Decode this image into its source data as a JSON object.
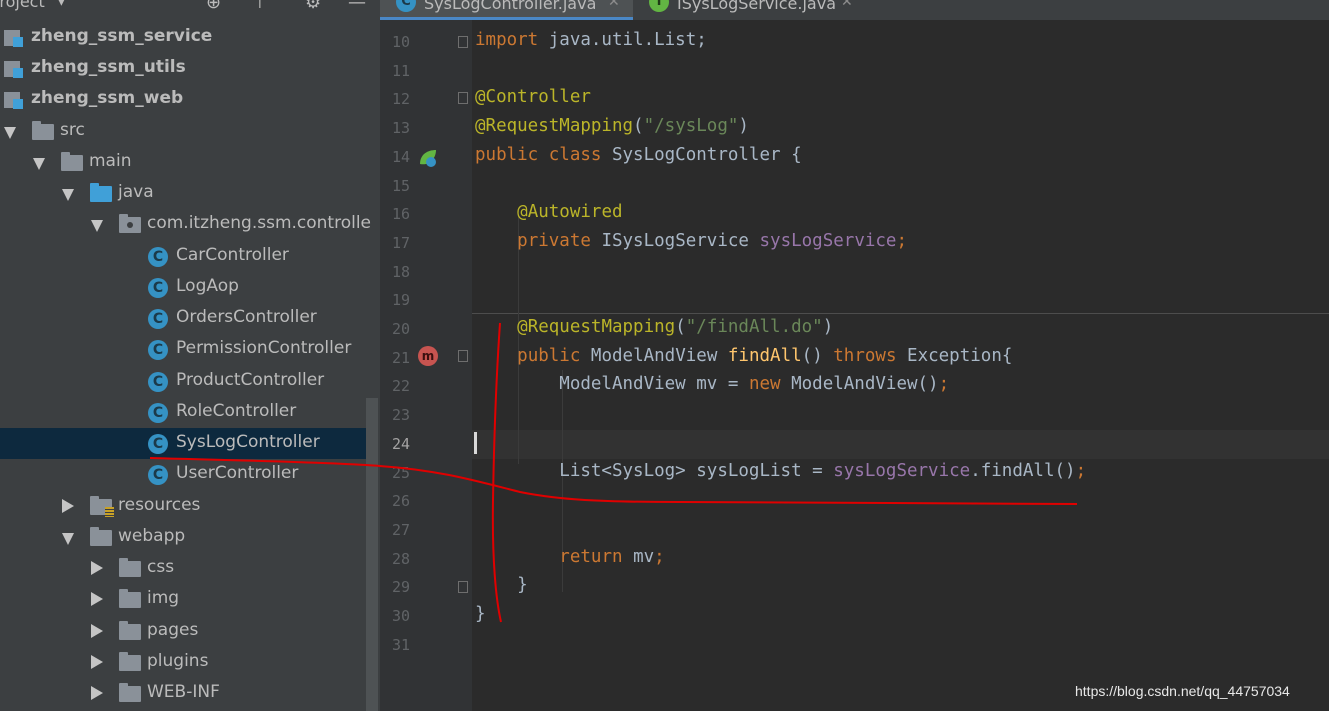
{
  "project_panel": {
    "title": "Project",
    "items": [
      {
        "label": "zheng_ssm_service",
        "icon": "module-icon",
        "expand": "none",
        "bold": true
      },
      {
        "label": "zheng_ssm_utils",
        "icon": "module-icon",
        "expand": "none",
        "bold": true
      },
      {
        "label": "zheng_ssm_web",
        "icon": "module-icon",
        "expand": "none",
        "bold": true
      },
      {
        "label": "src",
        "icon": "folder-icon",
        "expand": "down"
      },
      {
        "label": "main",
        "icon": "folder-icon",
        "expand": "down"
      },
      {
        "label": "java",
        "icon": "source-folder-icon",
        "expand": "down"
      },
      {
        "label": "com.itzheng.ssm.controlle",
        "icon": "package-icon",
        "expand": "down"
      },
      {
        "label": "CarController",
        "icon": "class-icon"
      },
      {
        "label": "LogAop",
        "icon": "class-icon"
      },
      {
        "label": "OrdersController",
        "icon": "class-icon"
      },
      {
        "label": "PermissionController",
        "icon": "class-icon"
      },
      {
        "label": "ProductController",
        "icon": "class-icon"
      },
      {
        "label": "RoleController",
        "icon": "class-icon"
      },
      {
        "label": "SysLogController",
        "icon": "class-icon",
        "selected": true
      },
      {
        "label": "UserController",
        "icon": "class-icon"
      },
      {
        "label": "resources",
        "icon": "resources-folder-icon",
        "expand": "right"
      },
      {
        "label": "webapp",
        "icon": "folder-icon",
        "expand": "down"
      },
      {
        "label": "css",
        "icon": "folder-icon",
        "expand": "right"
      },
      {
        "label": "img",
        "icon": "folder-icon",
        "expand": "right"
      },
      {
        "label": "pages",
        "icon": "folder-icon",
        "expand": "right"
      },
      {
        "label": "plugins",
        "icon": "folder-icon",
        "expand": "right"
      },
      {
        "label": "WEB-INF",
        "icon": "folder-icon",
        "expand": "right"
      }
    ]
  },
  "tabs": [
    {
      "label": "SysLogController.java",
      "icon": "class-icon",
      "active": true
    },
    {
      "label": "ISysLogService.java",
      "icon": "interface-icon",
      "active": false
    }
  ],
  "editor": {
    "current_line": 24,
    "lines": [
      {
        "num": "10",
        "tokens": [
          {
            "t": "import",
            "c": "kw"
          },
          {
            "t": " java.util.List;",
            "c": ""
          }
        ]
      },
      {
        "num": "11",
        "tokens": []
      },
      {
        "num": "12",
        "tokens": [
          {
            "t": "@Controller",
            "c": "an"
          }
        ]
      },
      {
        "num": "13",
        "tokens": [
          {
            "t": "@RequestMapping",
            "c": "an"
          },
          {
            "t": "(",
            "c": ""
          },
          {
            "t": "\"/sysLog\"",
            "c": "str"
          },
          {
            "t": ")",
            "c": ""
          }
        ]
      },
      {
        "num": "14",
        "tokens": [
          {
            "t": "public class ",
            "c": "kw"
          },
          {
            "t": "SysLogController {",
            "c": ""
          }
        ]
      },
      {
        "num": "15",
        "tokens": []
      },
      {
        "num": "16",
        "tokens": [
          {
            "t": "    ",
            "c": ""
          },
          {
            "t": "@Autowired",
            "c": "an"
          }
        ]
      },
      {
        "num": "17",
        "tokens": [
          {
            "t": "    ",
            "c": ""
          },
          {
            "t": "private ",
            "c": "kw"
          },
          {
            "t": "ISysLogService ",
            "c": ""
          },
          {
            "t": "sysLogService",
            "c": "fld"
          },
          {
            "t": ";",
            "c": "kw"
          }
        ]
      },
      {
        "num": "18",
        "tokens": []
      },
      {
        "num": "19",
        "tokens": []
      },
      {
        "num": "20",
        "tokens": [
          {
            "t": "    ",
            "c": ""
          },
          {
            "t": "@RequestMapping",
            "c": "an"
          },
          {
            "t": "(",
            "c": ""
          },
          {
            "t": "\"/findAll.do\"",
            "c": "str"
          },
          {
            "t": ")",
            "c": ""
          }
        ]
      },
      {
        "num": "21",
        "tokens": [
          {
            "t": "    ",
            "c": ""
          },
          {
            "t": "public ",
            "c": "kw"
          },
          {
            "t": "ModelAndView ",
            "c": ""
          },
          {
            "t": "findAll",
            "c": "mth"
          },
          {
            "t": "() ",
            "c": ""
          },
          {
            "t": "throws ",
            "c": "kw"
          },
          {
            "t": "Exception{",
            "c": ""
          }
        ]
      },
      {
        "num": "22",
        "tokens": [
          {
            "t": "        ModelAndView mv = ",
            "c": ""
          },
          {
            "t": "new ",
            "c": "kw"
          },
          {
            "t": "ModelAndView()",
            "c": ""
          },
          {
            "t": ";",
            "c": "kw"
          }
        ]
      },
      {
        "num": "23",
        "tokens": []
      },
      {
        "num": "24",
        "tokens": []
      },
      {
        "num": "25",
        "tokens": [
          {
            "t": "        List<SysLog> sysLogList = ",
            "c": ""
          },
          {
            "t": "sysLogService",
            "c": "fld"
          },
          {
            "t": ".findAll()",
            "c": ""
          },
          {
            "t": ";",
            "c": "kw"
          }
        ]
      },
      {
        "num": "26",
        "tokens": []
      },
      {
        "num": "27",
        "tokens": []
      },
      {
        "num": "28",
        "tokens": [
          {
            "t": "        ",
            "c": ""
          },
          {
            "t": "return ",
            "c": "kw"
          },
          {
            "t": "mv",
            "c": ""
          },
          {
            "t": ";",
            "c": "kw"
          }
        ]
      },
      {
        "num": "29",
        "tokens": [
          {
            "t": "    }",
            "c": ""
          }
        ]
      },
      {
        "num": "30",
        "tokens": [
          {
            "t": "}",
            "c": ""
          }
        ]
      },
      {
        "num": "31",
        "tokens": []
      }
    ]
  },
  "watermark": "https://blog.csdn.net/qq_44757034",
  "colors": {
    "annotation": "#bbb529",
    "keyword": "#cc7832",
    "string": "#6a8759",
    "field": "#9876aa",
    "method": "#ffc66d",
    "red_ink": "#e00000"
  }
}
